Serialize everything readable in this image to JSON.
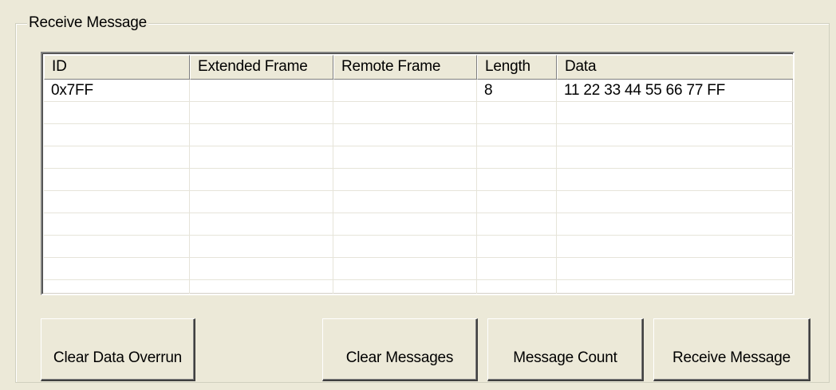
{
  "group": {
    "title": "Receive Message"
  },
  "table": {
    "columns": [
      "ID",
      "Extended Frame",
      "Remote Frame",
      "Length",
      "Data"
    ],
    "rows": [
      [
        "0x7FF",
        "",
        "",
        "8",
        "11 22 33 44 55 66 77 FF"
      ],
      [
        "",
        "",
        "",
        "",
        ""
      ],
      [
        "",
        "",
        "",
        "",
        ""
      ],
      [
        "",
        "",
        "",
        "",
        ""
      ],
      [
        "",
        "",
        "",
        "",
        ""
      ],
      [
        "",
        "",
        "",
        "",
        ""
      ],
      [
        "",
        "",
        "",
        "",
        ""
      ],
      [
        "",
        "",
        "",
        "",
        ""
      ],
      [
        "",
        "",
        "",
        "",
        ""
      ],
      [
        "",
        "",
        "",
        "",
        ""
      ]
    ]
  },
  "buttons": {
    "clear_data_overrun": "Clear Data Overrun",
    "clear_messages": "Clear Messages",
    "message_count": "Message Count",
    "receive_message": "Receive Message"
  },
  "colors": {
    "background": "#ece9d8",
    "list_background": "#ffffff",
    "grid_line": "#e6e4d9"
  }
}
